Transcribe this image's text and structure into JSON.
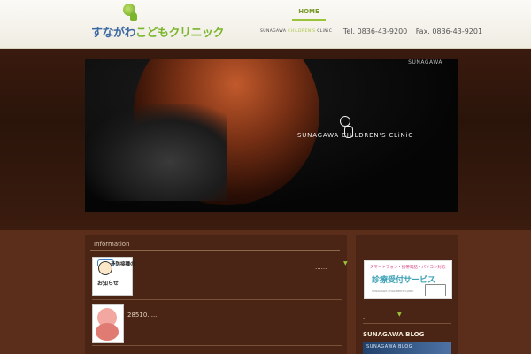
{
  "header": {
    "logo_text_a": "すながわ",
    "logo_text_b": "こどもクリニック",
    "logo_sub": "SUNAGAWA CHILDREN'S CLINIC",
    "nav_home": "HOME",
    "contact_clinic_a": "SUNAGAWA",
    "contact_clinic_b": "CHiLDREN'S",
    "contact_clinic_c": "CLiNiC",
    "tel": "Tel. 0836-43-9200",
    "fax": "Fax. 0836-43-9201"
  },
  "hero": {
    "corner_label": "SUNAGAWA",
    "title": "SUNAGAWA CHiLDREN'S CLiNiC"
  },
  "info": {
    "title": "Information",
    "items": [
      {
        "thumb_text_top": "予防接種の",
        "thumb_text_bottom": "お知らせ",
        "text": "......",
        "arrow": "▼"
      },
      {
        "text": "28510......"
      }
    ]
  },
  "side": {
    "banner_line1": "スマートフォン・携帯電話・パソコン対応",
    "banner_line2": "診療受付サービス",
    "banner_line3": "SUNAGAWA CHILDREN'S CLINIC",
    "dots": "..",
    "arrow": "▼",
    "blog_title": "SUNAGAWA BLOG",
    "blog_banner": "SUNAGAWA BLOG"
  }
}
